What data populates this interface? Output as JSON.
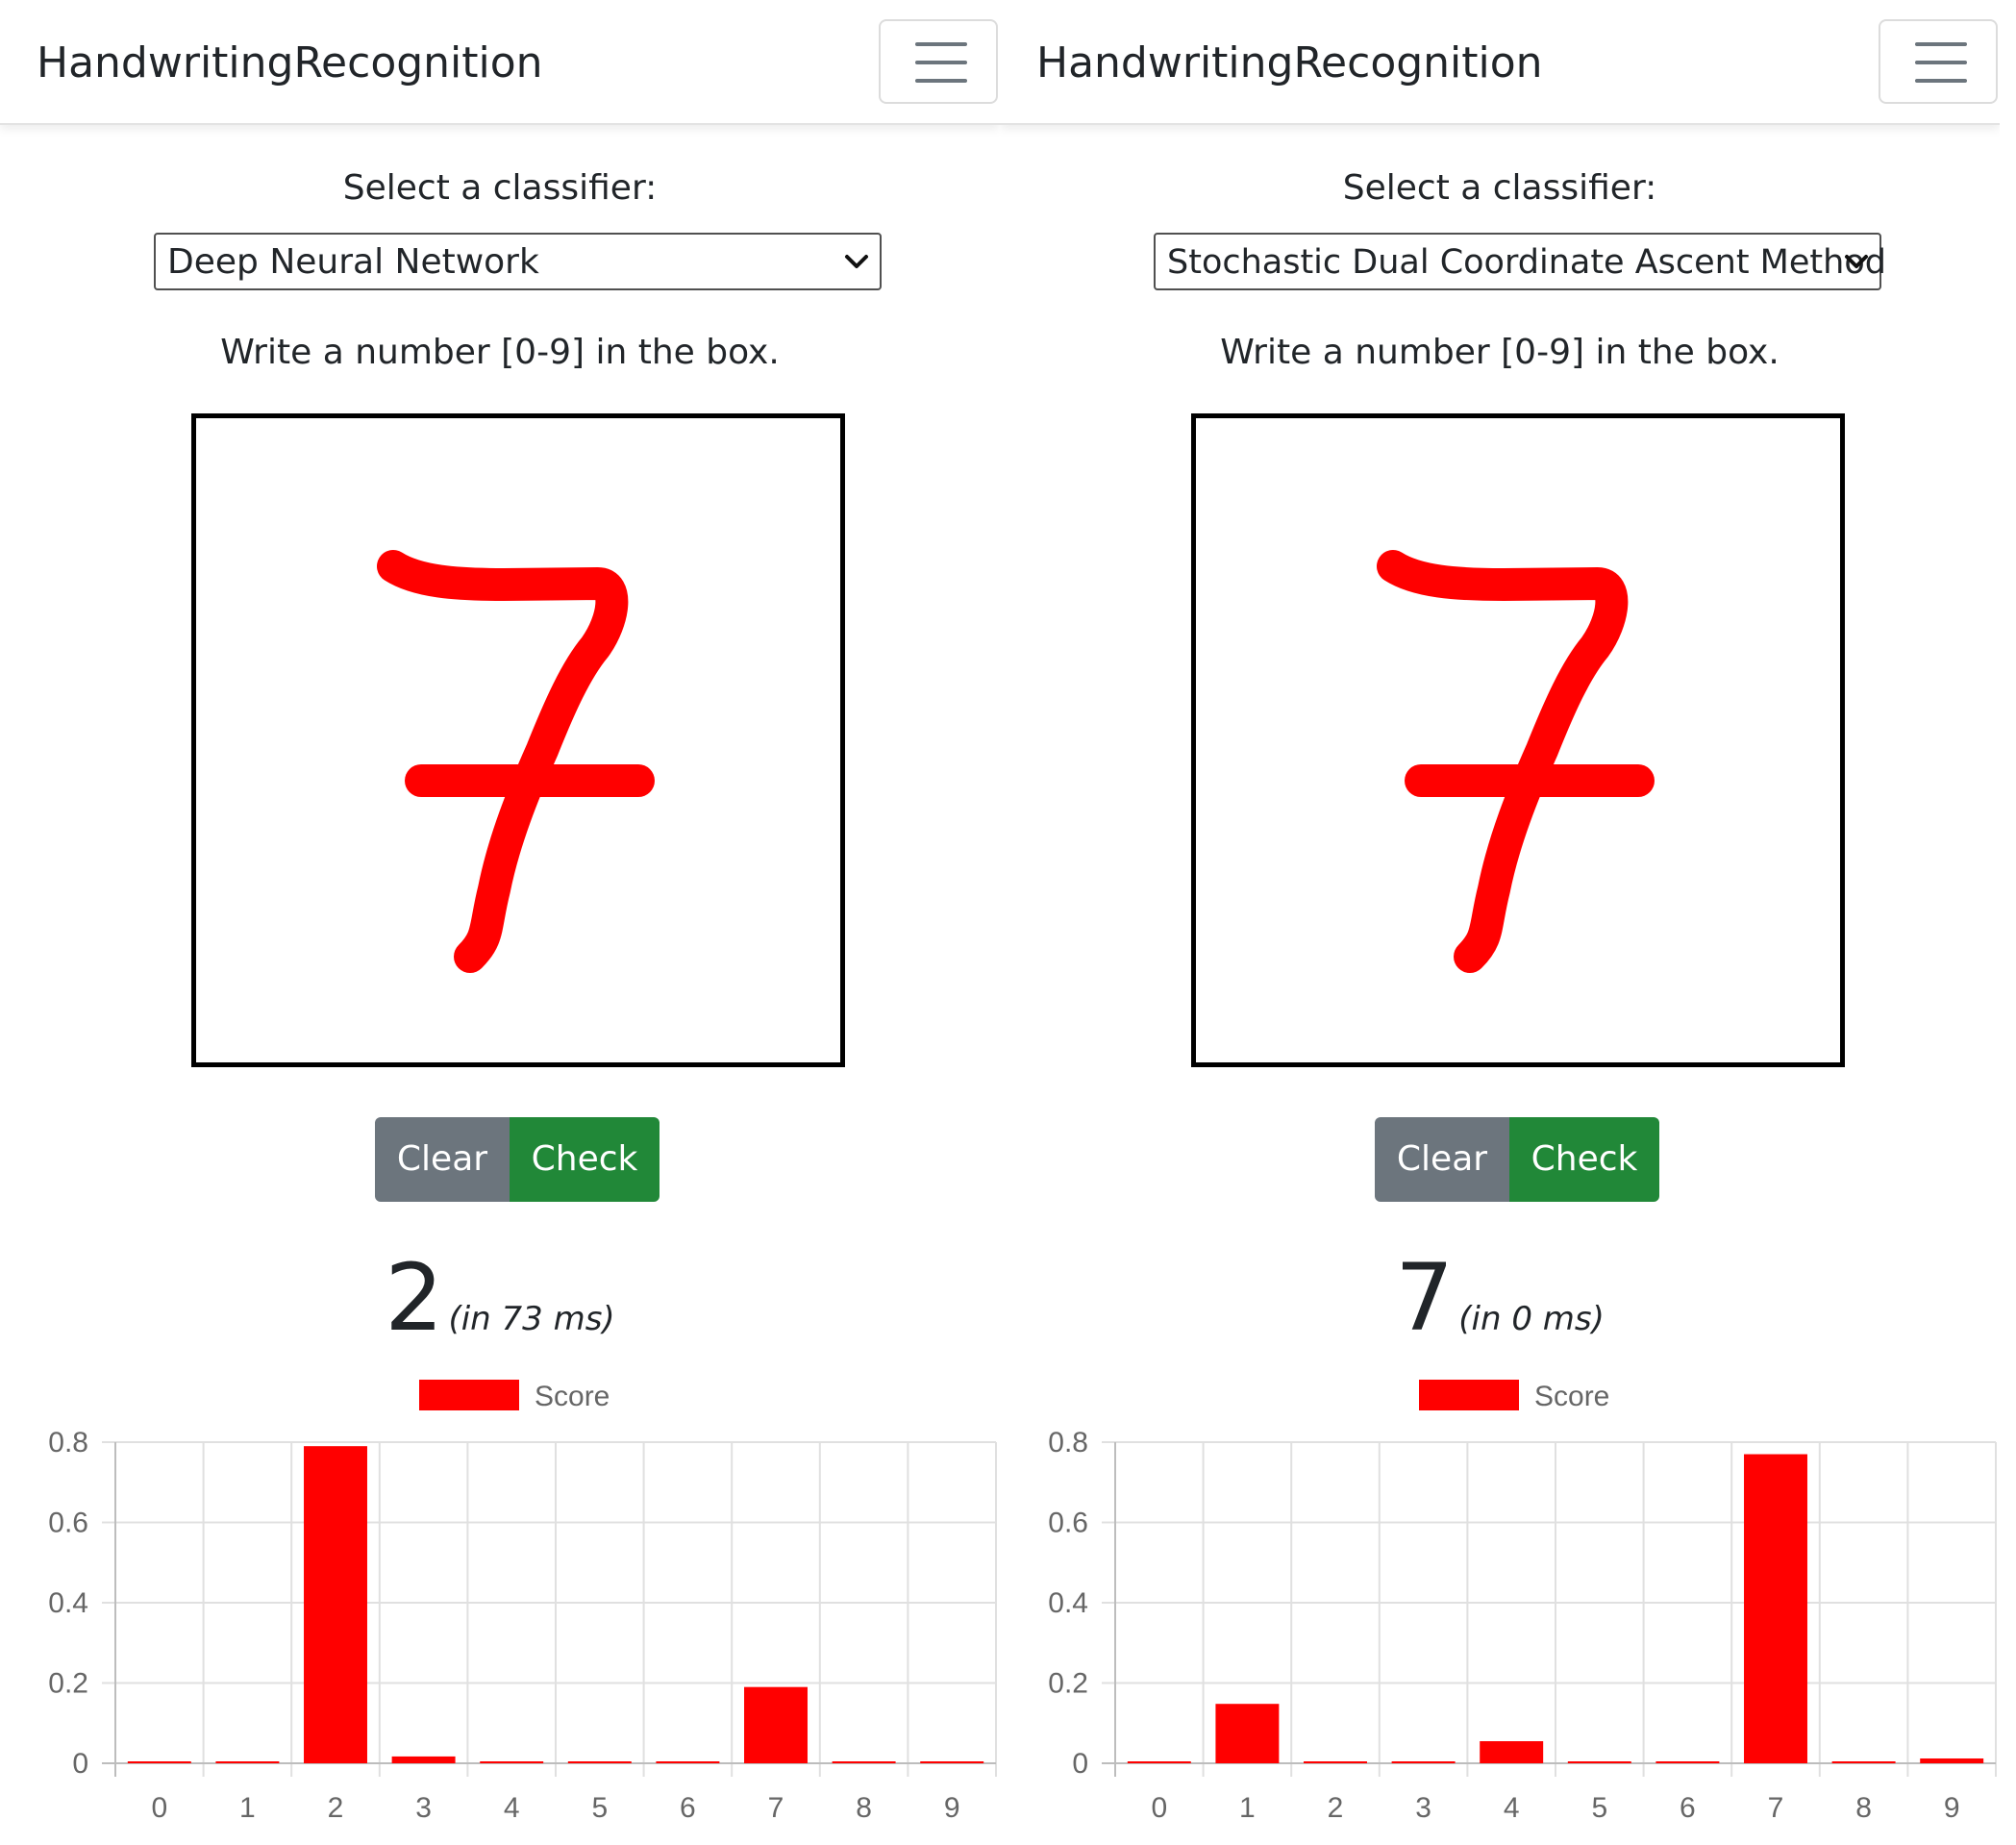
{
  "accent_color": "#ff0000",
  "panels": [
    {
      "brand": "HandwritingRecognition",
      "menu_icon": "hamburger-menu-icon",
      "select_label": "Select a classifier:",
      "classifier": "Deep Neural Network",
      "instruction": "Write a number [0-9] in the box.",
      "clear_label": "Clear",
      "check_label": "Check",
      "prediction": "2",
      "timing": "(in 73 ms)",
      "chart_data": {
        "type": "bar",
        "categories": [
          "0",
          "1",
          "2",
          "3",
          "4",
          "5",
          "6",
          "7",
          "8",
          "9"
        ],
        "series": [
          {
            "name": "Score",
            "color": "#ff0000",
            "values": [
              0.002,
              0.001,
              0.79,
              0.017,
              0.002,
              0.002,
              0.002,
              0.19,
              0.002,
              0.002
            ]
          }
        ],
        "yticks": [
          "0",
          "0.2",
          "0.4",
          "0.6",
          "0.8"
        ],
        "ylim": [
          0,
          0.8
        ],
        "grid": true,
        "legend": "top"
      }
    },
    {
      "brand": "HandwritingRecognition",
      "menu_icon": "hamburger-menu-icon",
      "select_label": "Select a classifier:",
      "classifier": "Stochastic Dual Coordinate Ascent Method",
      "instruction": "Write a number [0-9] in the box.",
      "clear_label": "Clear",
      "check_label": "Check",
      "prediction": "7",
      "timing": "(in 0 ms)",
      "chart_data": {
        "type": "bar",
        "categories": [
          "0",
          "1",
          "2",
          "3",
          "4",
          "5",
          "6",
          "7",
          "8",
          "9"
        ],
        "series": [
          {
            "name": "Score",
            "color": "#ff0000",
            "values": [
              0.002,
              0.148,
              0.002,
              0.001,
              0.055,
              0.002,
              0.002,
              0.77,
              0.001,
              0.012
            ]
          }
        ],
        "yticks": [
          "0",
          "0.2",
          "0.4",
          "0.6",
          "0.8"
        ],
        "ylim": [
          0,
          0.8
        ],
        "grid": true,
        "legend": "top"
      }
    }
  ]
}
